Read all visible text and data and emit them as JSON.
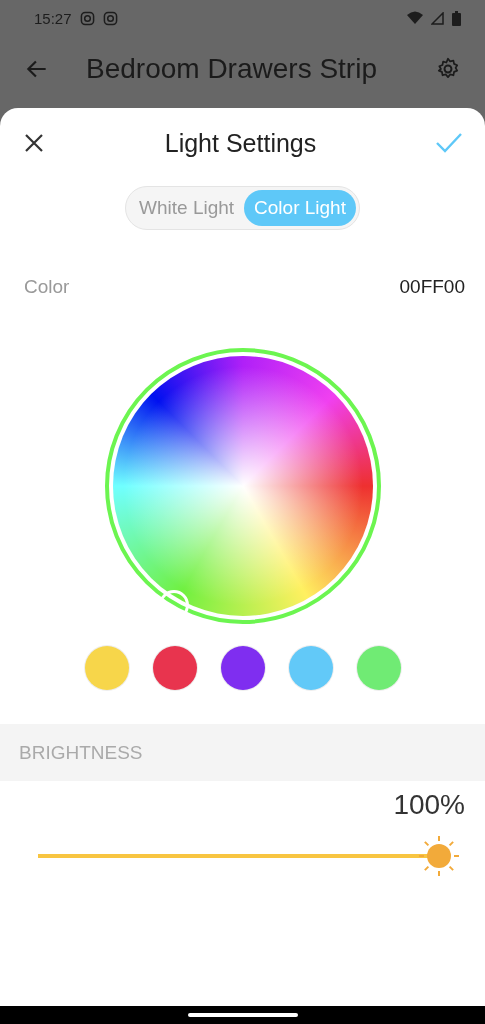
{
  "status_bar": {
    "time": "15:27"
  },
  "app_bar": {
    "title": "Bedroom Drawers Strip"
  },
  "sheet": {
    "title": "Light Settings",
    "modes": [
      {
        "label": "White Light",
        "selected": false
      },
      {
        "label": "Color Light",
        "selected": true
      }
    ],
    "color": {
      "label": "Color",
      "value": "00FF00"
    },
    "swatches": [
      {
        "color": "#f7d64a"
      },
      {
        "color": "#e8344e"
      },
      {
        "color": "#7f2ef0"
      },
      {
        "color": "#62c9f8"
      },
      {
        "color": "#70eb74"
      }
    ],
    "brightness": {
      "heading": "BRIGHTNESS",
      "reading": "100%",
      "level": 1.0
    }
  }
}
